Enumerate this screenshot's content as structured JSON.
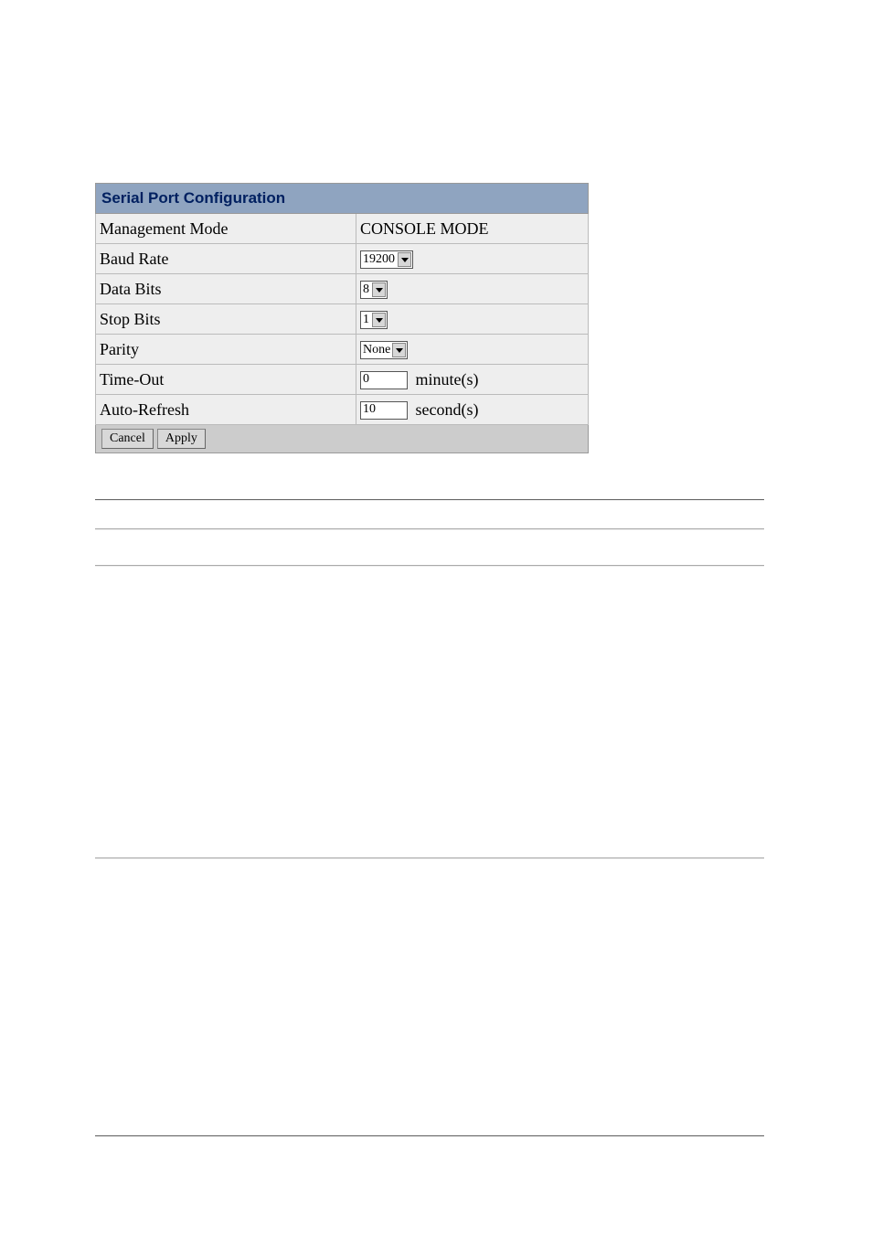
{
  "panel": {
    "title": "Serial Port Configuration",
    "rows": {
      "management_mode": {
        "label": "Management Mode",
        "value": "CONSOLE MODE"
      },
      "baud_rate": {
        "label": "Baud Rate",
        "value": "19200"
      },
      "data_bits": {
        "label": "Data Bits",
        "value": "8"
      },
      "stop_bits": {
        "label": "Stop Bits",
        "value": "1"
      },
      "parity": {
        "label": "Parity",
        "value": "None"
      },
      "time_out": {
        "label": "Time-Out",
        "value": "0",
        "unit": "minute(s)"
      },
      "auto_refresh": {
        "label": "Auto-Refresh",
        "value": "10",
        "unit": "second(s)"
      }
    },
    "buttons": {
      "cancel": "Cancel",
      "apply": "Apply"
    }
  }
}
